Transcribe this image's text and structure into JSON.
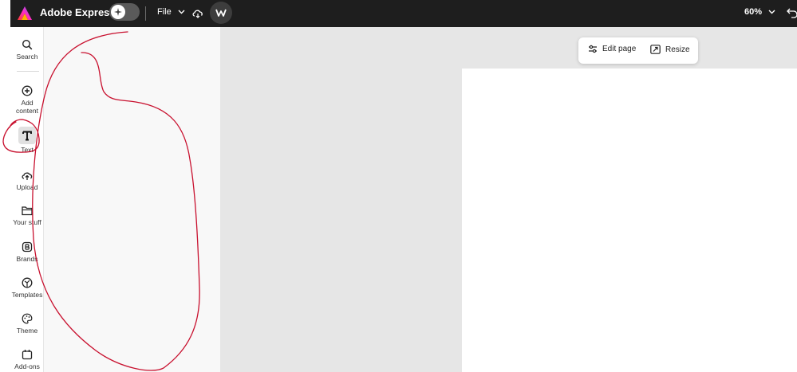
{
  "topbar": {
    "app_title": "Adobe Express",
    "file_label": "File",
    "zoom_label": "60%"
  },
  "rail": {
    "items": [
      {
        "label": "Search",
        "icon": "search-icon"
      },
      {
        "label": "Add content",
        "icon": "plus-circle-icon"
      },
      {
        "label": "Text",
        "icon": "text-icon"
      },
      {
        "label": "Upload",
        "icon": "upload-icon"
      },
      {
        "label": "Your stuff",
        "icon": "folder-icon"
      },
      {
        "label": "Brands",
        "icon": "brand-icon"
      },
      {
        "label": "Templates",
        "icon": "templates-icon"
      },
      {
        "label": "Theme",
        "icon": "palette-icon"
      },
      {
        "label": "Add-ons",
        "icon": "addons-icon"
      }
    ]
  },
  "canvas_toolbar": {
    "edit_page_label": "Edit page",
    "resize_label": "Resize"
  },
  "colors": {
    "topbar": "#1e1e1e",
    "panel": "#f8f8f8",
    "canvas": "#e6e6e6",
    "annotation": "#c8102e"
  }
}
